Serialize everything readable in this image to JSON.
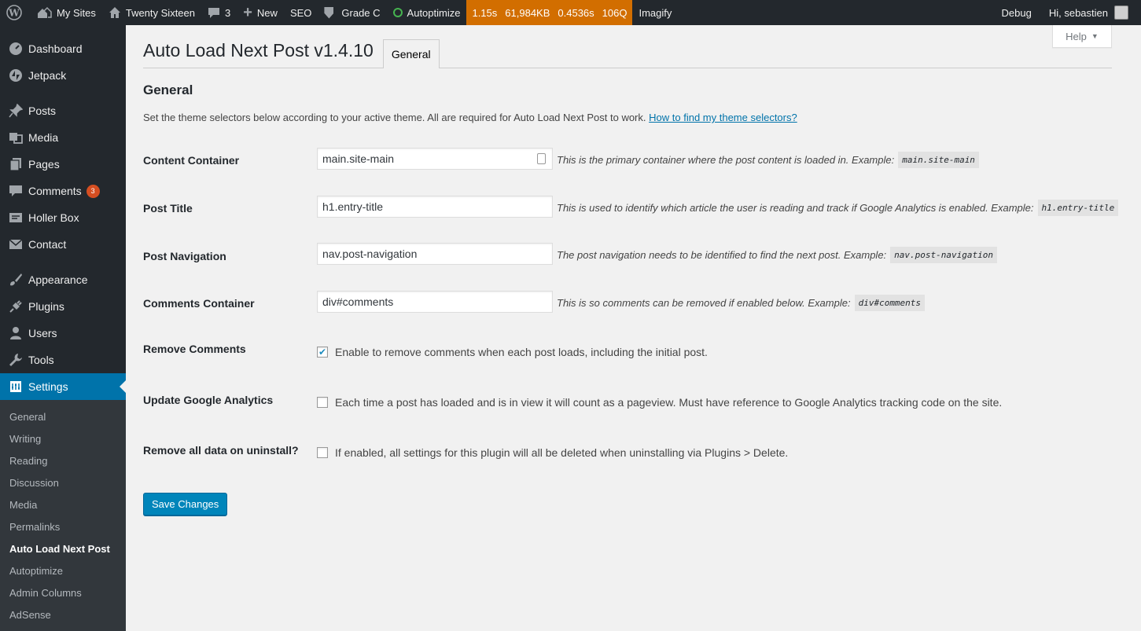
{
  "adminbar": {
    "my_sites": "My Sites",
    "site_name": "Twenty Sixteen",
    "comments_count": "3",
    "new": "New",
    "seo": "SEO",
    "grade": "Grade C",
    "autoptimize": "Autoptimize",
    "perf": [
      "1.15s",
      "61,984KB",
      "0.4536s",
      "106Q"
    ],
    "imagify": "Imagify",
    "debug": "Debug",
    "greeting": "Hi, sebastien",
    "perf_color": "#d26e00"
  },
  "sidebar": {
    "dashboard": "Dashboard",
    "jetpack": "Jetpack",
    "posts": "Posts",
    "media": "Media",
    "pages": "Pages",
    "comments": "Comments",
    "comments_badge": "3",
    "holler_box": "Holler Box",
    "contact": "Contact",
    "appearance": "Appearance",
    "plugins": "Plugins",
    "users": "Users",
    "tools": "Tools",
    "settings": "Settings",
    "submenu": [
      "General",
      "Writing",
      "Reading",
      "Discussion",
      "Media",
      "Permalinks",
      "Auto Load Next Post",
      "Autoptimize",
      "Admin Columns",
      "AdSense"
    ]
  },
  "page": {
    "help": "Help",
    "title": "Auto Load Next Post v1.4.10",
    "tab": "General",
    "section_title": "General",
    "intro_text": "Set the theme selectors below according to your active theme. All are required for Auto Load Next Post to work.",
    "intro_link": "How to find my theme selectors?",
    "fields": [
      {
        "label": "Content Container",
        "value": "main.site-main",
        "desc": "This is the primary container where the post content is loaded in. Example:",
        "example": "main.site-main"
      },
      {
        "label": "Post Title",
        "value": "h1.entry-title",
        "desc": "This is used to identify which article the user is reading and track if Google Analytics is enabled. Example:",
        "example": "h1.entry-title"
      },
      {
        "label": "Post Navigation",
        "value": "nav.post-navigation",
        "desc": "The post navigation needs to be identified to find the next post. Example:",
        "example": "nav.post-navigation"
      },
      {
        "label": "Comments Container",
        "value": "div#comments",
        "desc": "This is so comments can be removed if enabled below. Example:",
        "example": "div#comments"
      }
    ],
    "checkboxes": [
      {
        "label": "Remove Comments",
        "text": "Enable to remove comments when each post loads, including the initial post.",
        "checked": true
      },
      {
        "label": "Update Google Analytics",
        "text": "Each time a post has loaded and is in view it will count as a pageview. Must have reference to Google Analytics tracking code on the site.",
        "checked": false
      },
      {
        "label": "Remove all data on uninstall?",
        "text": "If enabled, all settings for this plugin will all be deleted when uninstalling via Plugins > Delete.",
        "checked": false
      }
    ],
    "save": "Save Changes",
    "accent": "#0073aa",
    "button_color": "#0085ba"
  }
}
